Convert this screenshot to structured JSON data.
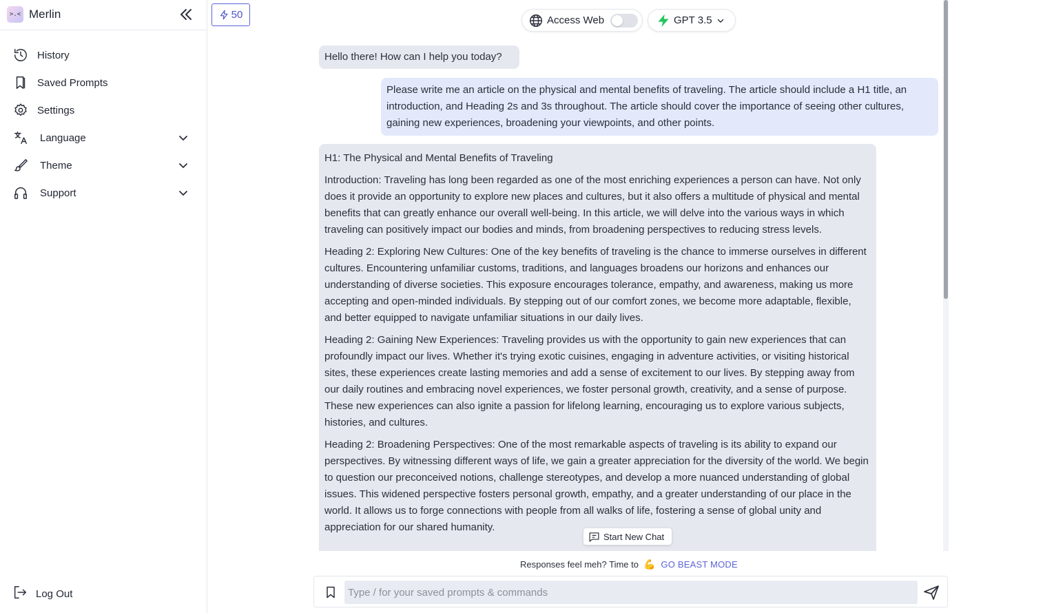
{
  "sidebar": {
    "brand": {
      "name": "Merlin",
      "logo_text": ">.<"
    },
    "items": [
      {
        "label": "History",
        "icon": "history-icon"
      },
      {
        "label": "Saved Prompts",
        "icon": "bookmark-icon"
      },
      {
        "label": "Settings",
        "icon": "gear-icon"
      },
      {
        "label": "Language",
        "icon": "translate-icon"
      },
      {
        "label": "Theme",
        "icon": "brush-icon"
      },
      {
        "label": "Support",
        "icon": "headset-icon"
      }
    ],
    "logout": {
      "label": "Log Out",
      "icon": "logout-icon"
    }
  },
  "credits": {
    "count": "50",
    "icon": "lightning-icon"
  },
  "toolbar": {
    "access_web": {
      "label": "Access Web",
      "enabled": false
    },
    "model": {
      "label": "GPT 3.5"
    }
  },
  "messages": {
    "greeting": "Hello there! How can I help you today?",
    "user": "Please write me an article on the physical and mental benefits of traveling. The article should include a H1 title, an introduction, and Heading 2s and 3s throughout. The article should cover the importance of seeing other cultures, gaining new experiences, broadening your viewpoints, and other points.",
    "answer": [
      "H1: The Physical and Mental Benefits of Traveling",
      "Introduction: Traveling has long been regarded as one of the most enriching experiences a person can have. Not only does it provide an opportunity to explore new places and cultures, but it also offers a multitude of physical and mental benefits that can greatly enhance our overall well-being. In this article, we will delve into the various ways in which traveling can positively impact our bodies and minds, from broadening perspectives to reducing stress levels.",
      "Heading 2: Exploring New Cultures: One of the key benefits of traveling is the chance to immerse ourselves in different cultures. Encountering unfamiliar customs, traditions, and languages broadens our horizons and enhances our understanding of diverse societies. This exposure encourages tolerance, empathy, and awareness, making us more accepting and open-minded individuals. By stepping out of our comfort zones, we become more adaptable, flexible, and better equipped to navigate unfamiliar situations in our daily lives.",
      "Heading 2: Gaining New Experiences: Traveling provides us with the opportunity to gain new experiences that can profoundly impact our lives. Whether it's trying exotic cuisines, engaging in adventure activities, or visiting historical sites, these experiences create lasting memories and add a sense of excitement to our lives. By stepping away from our daily routines and embracing novel experiences, we foster personal growth, creativity, and a sense of purpose. These new experiences can also ignite a passion for lifelong learning, encouraging us to explore various subjects, histories, and cultures.",
      "Heading 2: Broadening Perspectives: One of the most remarkable aspects of traveling is its ability to expand our perspectives. By witnessing different ways of life, we gain a greater appreciation for the diversity of the world. We begin to question our preconceived notions, challenge stereotypes, and develop a more nuanced understanding of global issues. This widened perspective fosters personal growth, empathy, and a greater understanding of our place in the world. It allows us to forge connections with people from all walks of life, fostering a sense of global unity and appreciation for our shared humanity."
    ]
  },
  "new_chat": {
    "label": "Start New Chat"
  },
  "beast_mode": {
    "prompt": "Responses feel meh? Time to",
    "emoji": "💪",
    "link": "GO BEAST MODE"
  },
  "composer": {
    "placeholder": "Type / for your saved prompts & commands",
    "value": ""
  },
  "colors": {
    "accent": "#5a63d6",
    "user_bubble": "#e3e8fb",
    "bot_bubble": "#e6e8ef",
    "lightning_green": "#22c55e"
  }
}
